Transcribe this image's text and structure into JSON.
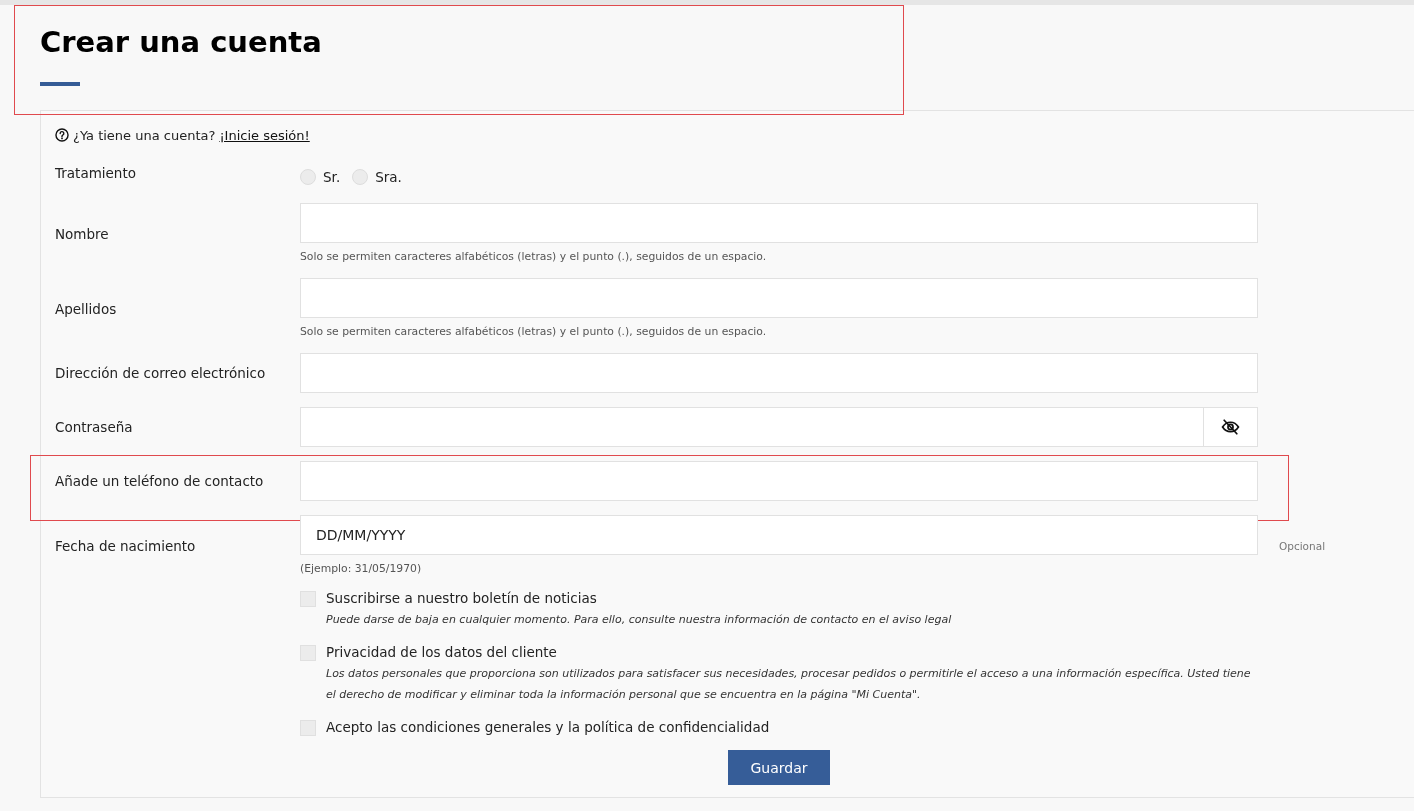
{
  "header": {
    "title": "Crear una cuenta",
    "highlighted": true
  },
  "login_prompt": {
    "text": "¿Ya tiene una cuenta?",
    "link": "¡Inicie sesión!"
  },
  "fields": [
    {
      "kind": "radio",
      "label": "Tratamiento",
      "highlighted": false,
      "options": [
        {
          "label": "Sr.",
          "selected": false
        },
        {
          "label": "Sra.",
          "selected": false
        }
      ]
    },
    {
      "kind": "text",
      "label": "Nombre",
      "highlighted": false,
      "hint": "Solo se permiten caracteres alfabéticos (letras) y el punto (.), seguidos de un espacio."
    },
    {
      "kind": "text",
      "label": "Apellidos",
      "highlighted": false,
      "hint": "Solo se permiten caracteres alfabéticos (letras) y el punto (.), seguidos de un espacio."
    },
    {
      "kind": "text",
      "label": "Dirección de correo electrónico",
      "highlighted": false
    },
    {
      "kind": "password",
      "label": "Contraseña",
      "highlighted": false
    },
    {
      "kind": "text",
      "label": "Añade un teléfono de contacto",
      "highlighted": true
    },
    {
      "kind": "text",
      "label": "Fecha de nacimiento",
      "highlighted": false,
      "placeholder": "DD/MM/YYYY",
      "hint": "(Ejemplo: 31/05/1970)",
      "note": "Opcional"
    }
  ],
  "checkboxes": [
    {
      "label": "Suscribirse a nuestro boletín de noticias",
      "checked": false,
      "hint": "Puede darse de baja en cualquier momento. Para ello, consulte nuestra información de contacto en el aviso legal"
    },
    {
      "label": "Privacidad de los datos del cliente",
      "checked": false,
      "hint": "Los datos personales que proporciona son utilizados para satisfacer sus necesidades, procesar pedidos o permitirle el acceso a una información específica. Usted tiene el derecho de modificar y eliminar toda la información personal que se encuentra en la página \"Mi Cuenta\"."
    },
    {
      "label": "Acepto las condiciones generales y la política de confidencialidad",
      "checked": false
    }
  ],
  "submit_button": {
    "label": "Guardar"
  }
}
